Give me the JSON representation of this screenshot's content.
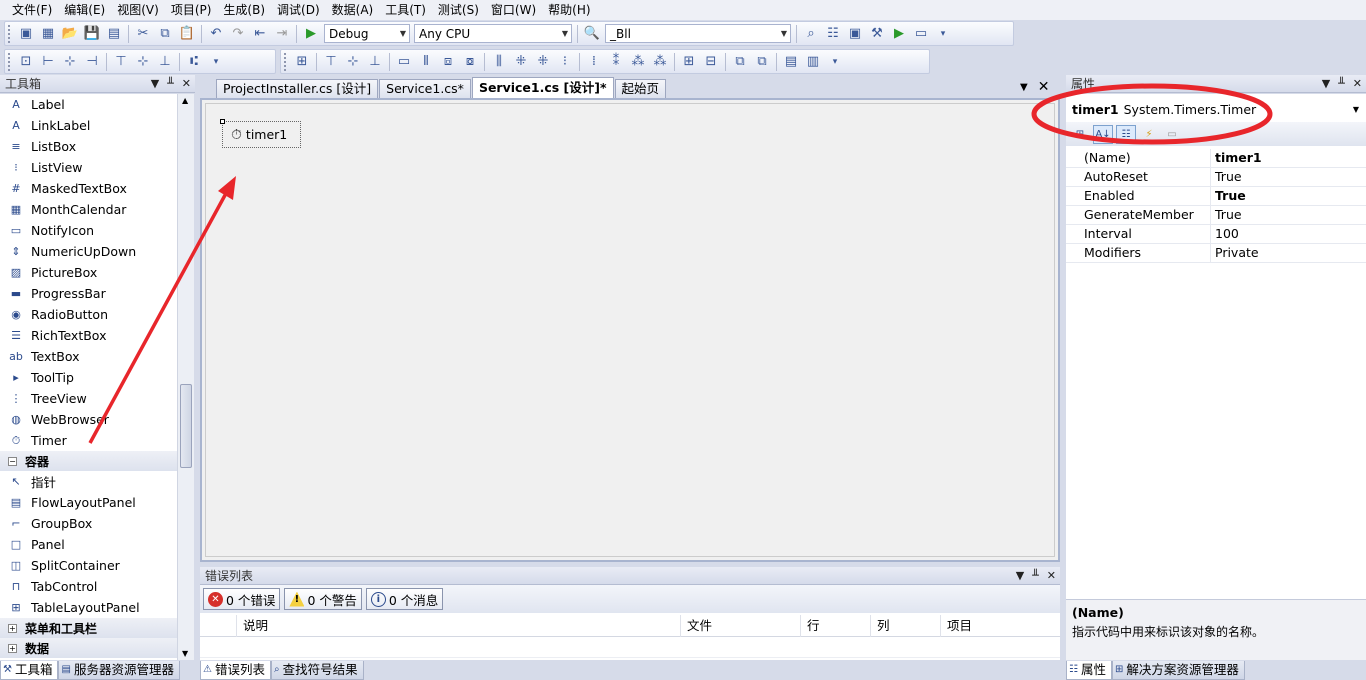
{
  "menu": [
    "文件(F)",
    "编辑(E)",
    "视图(V)",
    "项目(P)",
    "生成(B)",
    "调试(D)",
    "数据(A)",
    "工具(T)",
    "测试(S)",
    "窗口(W)",
    "帮助(H)"
  ],
  "toolbar": {
    "config": "Debug",
    "platform": "Any CPU",
    "find": "_Bll"
  },
  "toolbox": {
    "title": "工具箱",
    "items": [
      {
        "label": "Label",
        "icon": "A"
      },
      {
        "label": "LinkLabel",
        "icon": "A"
      },
      {
        "label": "ListBox",
        "icon": "≡"
      },
      {
        "label": "ListView",
        "icon": "⁝"
      },
      {
        "label": "MaskedTextBox",
        "icon": "#"
      },
      {
        "label": "MonthCalendar",
        "icon": "▦"
      },
      {
        "label": "NotifyIcon",
        "icon": "▭"
      },
      {
        "label": "NumericUpDown",
        "icon": "⇕"
      },
      {
        "label": "PictureBox",
        "icon": "▨"
      },
      {
        "label": "ProgressBar",
        "icon": "▬"
      },
      {
        "label": "RadioButton",
        "icon": "◉"
      },
      {
        "label": "RichTextBox",
        "icon": "☰"
      },
      {
        "label": "TextBox",
        "icon": "ab"
      },
      {
        "label": "ToolTip",
        "icon": "▸"
      },
      {
        "label": "TreeView",
        "icon": "⋮"
      },
      {
        "label": "WebBrowser",
        "icon": "◍"
      },
      {
        "label": "Timer",
        "icon": "⏱"
      }
    ],
    "category_containers": "容器",
    "containers": [
      {
        "label": "指针",
        "icon": "↖"
      },
      {
        "label": "FlowLayoutPanel",
        "icon": "▤"
      },
      {
        "label": "GroupBox",
        "icon": "⌐"
      },
      {
        "label": "Panel",
        "icon": "□"
      },
      {
        "label": "SplitContainer",
        "icon": "◫"
      },
      {
        "label": "TabControl",
        "icon": "⊓"
      },
      {
        "label": "TableLayoutPanel",
        "icon": "⊞"
      }
    ],
    "category_menus": "菜单和工具栏",
    "category_data": "数据"
  },
  "tabs": [
    "ProjectInstaller.cs [设计]",
    "Service1.cs*",
    "Service1.cs [设计]*",
    "起始页"
  ],
  "designer": {
    "component": "timer1"
  },
  "errors": {
    "title": "错误列表",
    "errors_btn": "0 个错误",
    "warnings_btn": "0 个警告",
    "messages_btn": "0 个消息",
    "columns": [
      "说明",
      "文件",
      "行",
      "列",
      "项目"
    ]
  },
  "properties": {
    "title": "属性",
    "selected_name": "timer1",
    "selected_type": "System.Timers.Timer",
    "rows": [
      {
        "name": "(Name)",
        "value": "timer1",
        "bold": true
      },
      {
        "name": "AutoReset",
        "value": "True",
        "bold": false
      },
      {
        "name": "Enabled",
        "value": "True",
        "bold": true
      },
      {
        "name": "GenerateMember",
        "value": "True",
        "bold": false
      },
      {
        "name": "Interval",
        "value": "100",
        "bold": false
      },
      {
        "name": "Modifiers",
        "value": "Private",
        "bold": false
      }
    ],
    "desc_title": "(Name)",
    "desc_text": "指示代码中用来标识该对象的名称。"
  },
  "bottom_left": [
    "工具箱",
    "服务器资源管理器"
  ],
  "bottom_mid": [
    "错误列表",
    "查找符号结果"
  ],
  "bottom_right": [
    "属性",
    "解决方案资源管理器"
  ],
  "colors": {
    "annotation": "#e8262b",
    "accent": "#2b4a8c"
  }
}
